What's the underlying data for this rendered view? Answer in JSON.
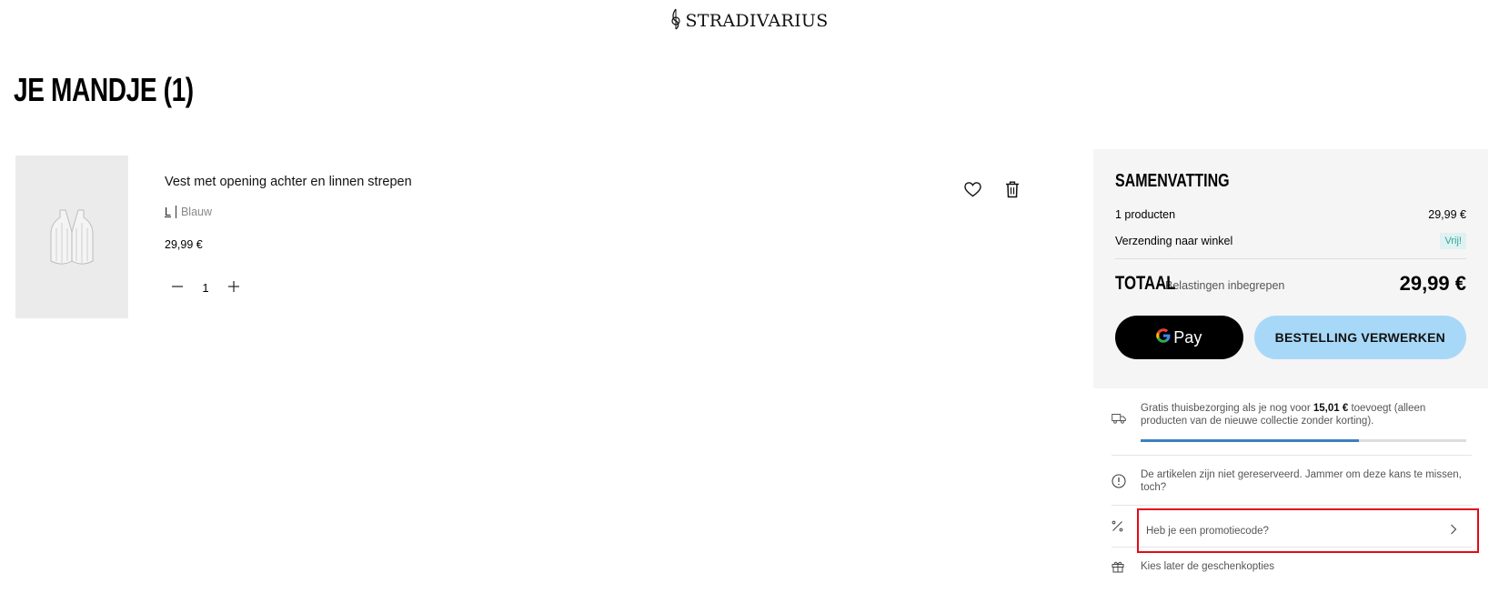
{
  "header": {
    "brand": "STRADIVARIUS"
  },
  "page": {
    "title": "JE MANDJE (1)"
  },
  "cart": {
    "items": [
      {
        "name": "Vest met opening achter en linnen strepen",
        "size": "L",
        "color": "Blauw",
        "price": "29,99 €",
        "quantity": "1"
      }
    ]
  },
  "summary": {
    "title": "SAMENVATTING",
    "products_label": "1 producten",
    "products_value": "29,99 €",
    "shipping_label": "Verzending naar winkel",
    "shipping_value": "Vrij!",
    "total_label": "TOTAAL",
    "total_note": "Belastingen inbegrepen",
    "total_value": "29,99 €",
    "gpay_label": "Pay",
    "checkout_label": "BESTELLING VERWERKEN"
  },
  "info": {
    "shipping_pre": "Gratis thuisbezorging als je nog voor",
    "shipping_amount": "15,01 €",
    "shipping_post": "toevoegt (alleen producten van de nieuwe collectie zonder korting).",
    "shipping_progress": 0.67,
    "reserve_text": "De artikelen zijn niet gereserveerd. Jammer om deze kans te missen, toch?",
    "promo_text": "Heb je een promotiecode?",
    "gift_text": "Kies later de geschenkopties"
  },
  "icons": [
    "stradivarius-logo-icon",
    "heart-icon",
    "trash-icon",
    "minus-icon",
    "plus-icon",
    "google-g-icon",
    "truck-icon",
    "alert-circle-icon",
    "percent-icon",
    "chevron-right-icon",
    "gift-icon"
  ],
  "colors": {
    "checkout_bg": "#a8d8f8",
    "free_badge_bg": "#dff1f0",
    "free_badge_text": "#2aa79b",
    "progress_fill": "#3e7fc1",
    "promo_highlight": "#e20a17"
  }
}
